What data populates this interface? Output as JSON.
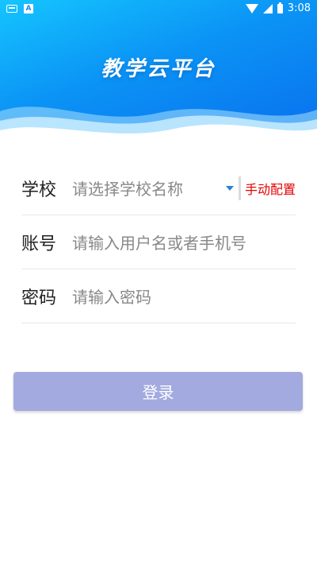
{
  "status_bar": {
    "time": "3:08",
    "left_icons": [
      "keyboard-icon",
      "a-icon"
    ],
    "a_icon_text": "A",
    "right_icons": [
      "wifi-icon",
      "signal-icon",
      "battery-icon"
    ]
  },
  "header": {
    "title": "教学云平台"
  },
  "form": {
    "school": {
      "label": "学校",
      "placeholder": "请选择学校名称",
      "manual_config": "手动配置"
    },
    "account": {
      "label": "账号",
      "placeholder": "请输入用户名或者手机号"
    },
    "password": {
      "label": "密码",
      "placeholder": "请输入密码"
    }
  },
  "login_button": {
    "label": "登录"
  },
  "colors": {
    "header_gradient_start": "#15c5ff",
    "header_gradient_end": "#0a6fee",
    "login_button": "#a2aadf",
    "manual_link": "#e60000",
    "dropdown_arrow": "#2e7fd1"
  }
}
